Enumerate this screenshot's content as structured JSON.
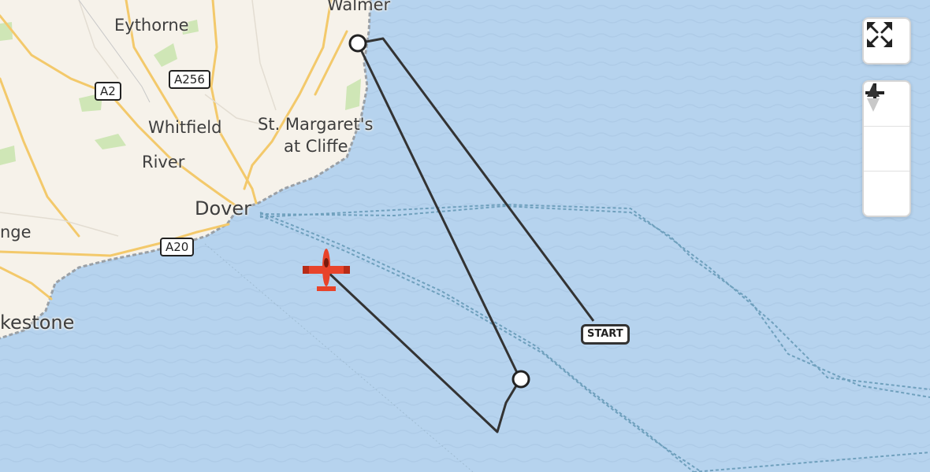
{
  "map": {
    "places": [
      {
        "id": "walmer",
        "name": "Walmer"
      },
      {
        "id": "eythorne",
        "name": "Eythorne"
      },
      {
        "id": "whitfield",
        "name": "Whitfield"
      },
      {
        "id": "stmargarets1",
        "name": "St. Margaret's"
      },
      {
        "id": "stmargarets2",
        "name": "at Cliffe"
      },
      {
        "id": "river",
        "name": "River"
      },
      {
        "id": "dover",
        "name": "Dover"
      },
      {
        "id": "hawkinge",
        "name": "nge"
      },
      {
        "id": "folkestone",
        "name": "kestone"
      }
    ],
    "roads": [
      {
        "id": "a2",
        "label": "A2"
      },
      {
        "id": "a256",
        "label": "A256"
      },
      {
        "id": "a20",
        "label": "A20"
      }
    ],
    "route": {
      "start_label": "START",
      "colors": {
        "line": "#333333",
        "water": "#b6d3ee",
        "land": "#f6f2ea",
        "ferry": "#6fa0bd",
        "aircraft": "#e8432a"
      }
    },
    "aircraft_icon": "plane-icon"
  },
  "controls": {
    "fullscreen_icon": "fullscreen-icon",
    "zoom_in_icon": "zoom-in-icon",
    "zoom_out_icon": "zoom-out-icon",
    "compass_icon": "compass-icon"
  }
}
